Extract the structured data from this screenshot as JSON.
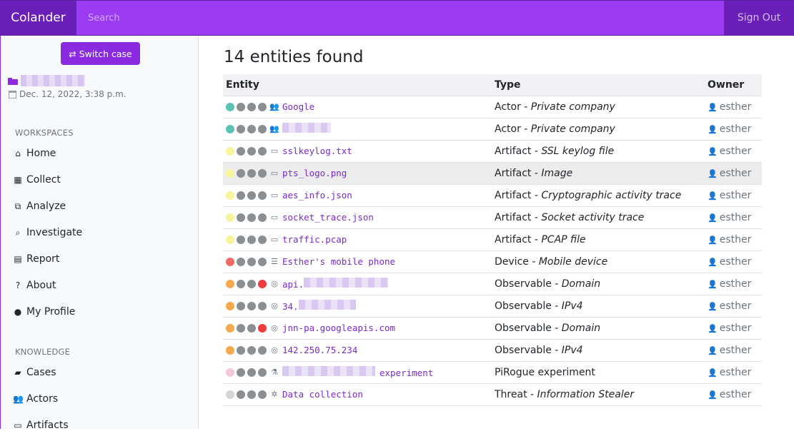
{
  "app": {
    "brand": "Colander",
    "search_placeholder": "Search",
    "sign_out": "Sign Out"
  },
  "sidebar": {
    "switch_case": "⇄ Switch case",
    "case_date": "Dec. 12, 2022, 3:38 p.m.",
    "workspaces_title": "WORKSPACES",
    "workspaces": [
      {
        "label": "Home",
        "icon": "home-icon"
      },
      {
        "label": "Collect",
        "icon": "grid-icon"
      },
      {
        "label": "Analyze",
        "icon": "cubes-icon"
      },
      {
        "label": "Investigate",
        "icon": "search-icon"
      },
      {
        "label": "Report",
        "icon": "file-icon"
      },
      {
        "label": "About",
        "icon": "question-icon"
      },
      {
        "label": "My Profile",
        "icon": "user-icon"
      }
    ],
    "knowledge_title": "KNOWLEDGE",
    "knowledge": [
      {
        "label": "Cases",
        "icon": "folder-icon"
      },
      {
        "label": "Actors",
        "icon": "users-icon"
      },
      {
        "label": "Artifacts",
        "icon": "archive-icon"
      }
    ]
  },
  "main": {
    "heading": "14 entities found",
    "columns": [
      "Entity",
      "Type",
      "Owner"
    ],
    "rows": [
      {
        "color": "#5cc3b4",
        "flag": false,
        "icon": "users-icon",
        "name": "Google",
        "kind": "Actor",
        "sub": "Private company",
        "owner": "esther"
      },
      {
        "color": "#5cc3b4",
        "flag": false,
        "icon": "users-icon",
        "name": "",
        "kind": "Actor",
        "sub": "Private company",
        "owner": "esther"
      },
      {
        "color": "#f7f49a",
        "flag": false,
        "icon": "archive-icon",
        "name": "sslkeylog.txt",
        "kind": "Artifact",
        "sub": "SSL keylog file",
        "owner": "esther"
      },
      {
        "color": "#f7f49a",
        "flag": false,
        "icon": "archive-icon",
        "name": "pts_logo.png",
        "kind": "Artifact",
        "sub": "Image",
        "owner": "esther"
      },
      {
        "color": "#f7f49a",
        "flag": false,
        "icon": "archive-icon",
        "name": "aes_info.json",
        "kind": "Artifact",
        "sub": "Cryptographic activity trace",
        "owner": "esther"
      },
      {
        "color": "#f7f49a",
        "flag": false,
        "icon": "archive-icon",
        "name": "socket_trace.json",
        "kind": "Artifact",
        "sub": "Socket activity trace",
        "owner": "esther"
      },
      {
        "color": "#f7f49a",
        "flag": false,
        "icon": "archive-icon",
        "name": "traffic.pcap",
        "kind": "Artifact",
        "sub": "PCAP file",
        "owner": "esther"
      },
      {
        "color": "#ee6b63",
        "flag": false,
        "icon": "server-icon",
        "name": "Esther's mobile phone",
        "kind": "Device",
        "sub": "Mobile device",
        "owner": "esther"
      },
      {
        "color": "#f5a94a",
        "flag": true,
        "icon": "target-icon",
        "name": "api.",
        "kind": "Observable",
        "sub": "Domain",
        "owner": "esther"
      },
      {
        "color": "#f5a94a",
        "flag": false,
        "icon": "target-icon",
        "name": "34.",
        "kind": "Observable",
        "sub": "IPv4",
        "owner": "esther"
      },
      {
        "color": "#f5a94a",
        "flag": true,
        "icon": "target-icon",
        "name": "jnn-pa.googleapis.com",
        "kind": "Observable",
        "sub": "Domain",
        "owner": "esther"
      },
      {
        "color": "#f5a94a",
        "flag": false,
        "icon": "target-icon",
        "name": "142.250.75.234",
        "kind": "Observable",
        "sub": "IPv4",
        "owner": "esther"
      },
      {
        "color": "#f6c6dd",
        "flag": false,
        "icon": "flask-icon",
        "name": "experiment",
        "kind": "PiRogue experiment",
        "sub": "",
        "owner": "esther"
      },
      {
        "color": "#d4d4d4",
        "flag": false,
        "icon": "bug-icon",
        "name": "Data collection",
        "kind": "Threat",
        "sub": "Information Stealer",
        "owner": "esther"
      }
    ]
  },
  "colors": {
    "accent": "#8a2be2",
    "flag_red": "#ee3b3b",
    "dot_grey": "#8a8f94"
  }
}
